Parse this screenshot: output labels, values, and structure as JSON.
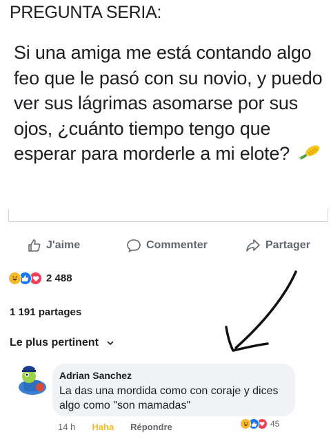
{
  "post": {
    "header": "PREGUNTA SERIA:",
    "body": "Si una amiga me está contando algo feo que le pasó con su novio, y puedo ver sus lágrimas asomarse por sus ojos, ¿cuánto tiempo tengo que esperar para morderle a mi elote?",
    "emoji_icon": "corn-icon"
  },
  "actions": {
    "like_label": "J'aime",
    "comment_label": "Commenter",
    "share_label": "Partager"
  },
  "reactions": {
    "types": [
      "haha",
      "like",
      "love"
    ],
    "count": "2 488"
  },
  "shares_text": "1 191 partages",
  "sort_label": "Le plus pertinent",
  "comment": {
    "author": "Adrian Sanchez",
    "text": "La das una mordida como con coraje y dices algo como \"son mamadas\"",
    "time": "14 h",
    "haha_label": "Haha",
    "reply_label": "Répondre",
    "reaction_count": "45"
  },
  "colors": {
    "like_blue": "#1877f2",
    "love_red": "#f33e58",
    "haha_yellow": "#f7b928",
    "meta_gray": "#65676b",
    "bubble_bg": "#f0f2f5"
  }
}
